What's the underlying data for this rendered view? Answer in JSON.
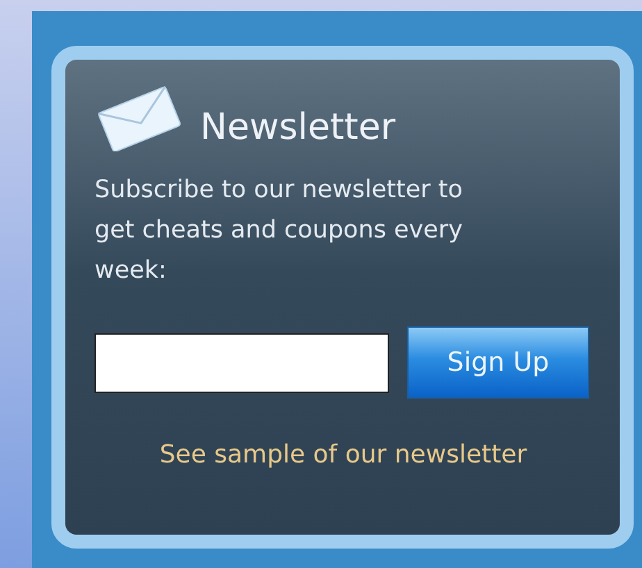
{
  "newsletter": {
    "title": "Newsletter",
    "description": "Subscribe to our newsletter to get cheats and coupons every week:",
    "signup_button": "Sign Up",
    "sample_link": "See sample of our newsletter"
  }
}
